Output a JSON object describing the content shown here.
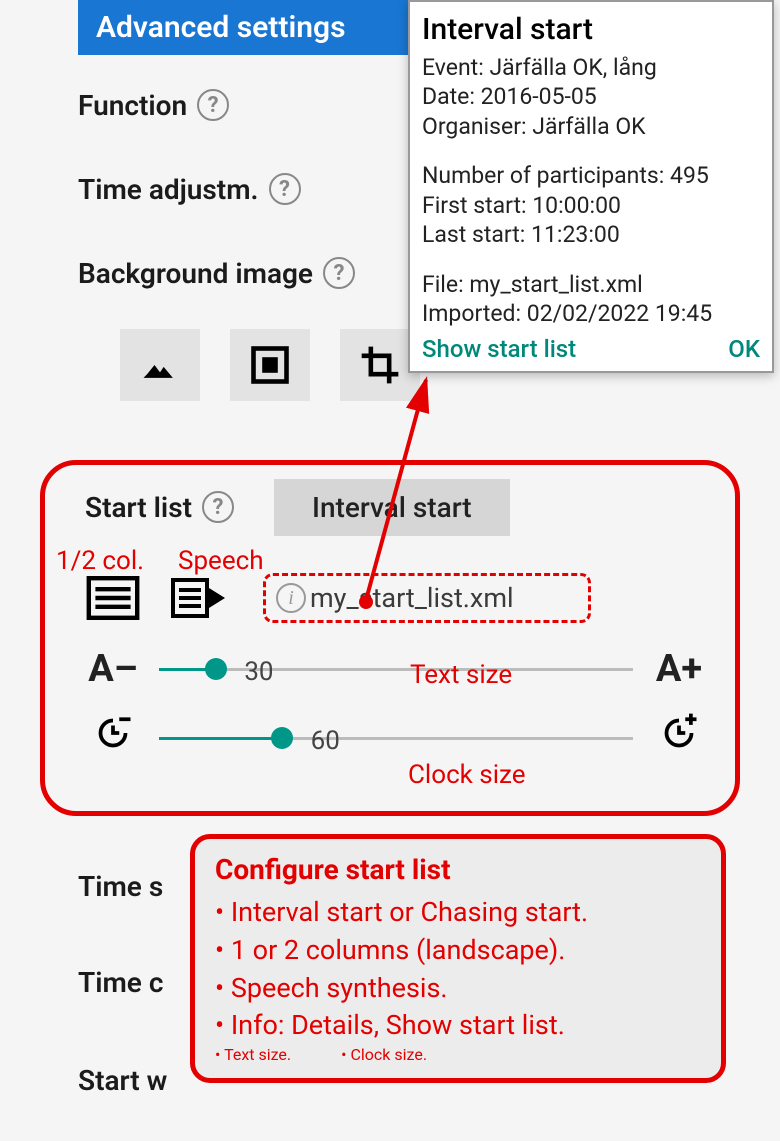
{
  "header": {
    "title": "Advanced settings"
  },
  "rows": {
    "function": "Function",
    "time_adjust": "Time adjustm.",
    "bg_image": "Background image",
    "start_list": "Start list",
    "time_s": "Time s",
    "time_c": "Time c",
    "start_w": "Start w"
  },
  "btn": {
    "interval_start": "Interval start"
  },
  "file": {
    "name": "my_start_list.xml"
  },
  "annotations": {
    "col": "1/2 col.",
    "speech": "Speech",
    "text": "Text size",
    "clock": "Clock size"
  },
  "sliders": {
    "text": {
      "value": 30,
      "pct": 12
    },
    "clock": {
      "value": 60,
      "pct": 26
    }
  },
  "glyphs": {
    "aminus": "A–",
    "aplus": "A+"
  },
  "dialog": {
    "title": "Interval start",
    "event": "Event: Järfälla OK, lång",
    "date": "Date: 2016-05-05",
    "organiser": "Organiser: Järfälla OK",
    "participants": "Number of participants: 495",
    "first": "First start: 10:00:00",
    "last": "Last start: 11:23:00",
    "file": "File: my_start_list.xml",
    "imported": "Imported: 02/02/2022 19:45",
    "show": "Show start list",
    "ok": "OK"
  },
  "tip": {
    "title": "Configure start list",
    "items": [
      "Interval start or Chasing start.",
      "1 or 2 columns (landscape).",
      "Speech synthesis.",
      "Info: Details, Show start list."
    ],
    "last_a": "Text size.",
    "last_b": "Clock size."
  }
}
